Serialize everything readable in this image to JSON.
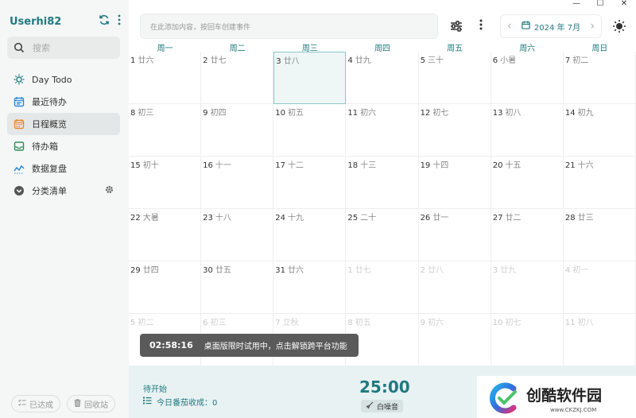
{
  "sidebar": {
    "user_name": "Userhi82",
    "search_placeholder": "搜索",
    "items": [
      {
        "label": "Day Todo",
        "icon": "sun-icon",
        "color": "#1f7a80"
      },
      {
        "label": "最近待办",
        "icon": "calendar-list-icon",
        "color": "#2d8ad6"
      },
      {
        "label": "日程概览",
        "icon": "calendar-grid-icon",
        "color": "#e88a2c"
      },
      {
        "label": "待办箱",
        "icon": "inbox-icon",
        "color": "#2f8f57"
      },
      {
        "label": "数据复盘",
        "icon": "chart-line-icon",
        "color": "#2d8ad6"
      },
      {
        "label": "分类清单",
        "icon": "chevron-down-circle-icon",
        "color": "#555555"
      }
    ],
    "bottom": {
      "completed_label": "已达成",
      "trash_label": "回收站"
    }
  },
  "topbar": {
    "add_placeholder": "在此添加内容，按回车创建事件",
    "month_label": "2024 年 7月"
  },
  "calendar": {
    "weekdays": [
      "周一",
      "周二",
      "周三",
      "周四",
      "周五",
      "周六",
      "周日"
    ],
    "weeks": [
      [
        {
          "d": "1",
          "l": "廿六"
        },
        {
          "d": "2",
          "l": "廿七"
        },
        {
          "d": "3",
          "l": "廿八",
          "today": true
        },
        {
          "d": "4",
          "l": "廿九"
        },
        {
          "d": "5",
          "l": "三十"
        },
        {
          "d": "6",
          "l": "小暑"
        },
        {
          "d": "7",
          "l": "初二"
        }
      ],
      [
        {
          "d": "8",
          "l": "初三"
        },
        {
          "d": "9",
          "l": "初四"
        },
        {
          "d": "10",
          "l": "初五"
        },
        {
          "d": "11",
          "l": "初六"
        },
        {
          "d": "12",
          "l": "初七"
        },
        {
          "d": "13",
          "l": "初八"
        },
        {
          "d": "14",
          "l": "初九"
        }
      ],
      [
        {
          "d": "15",
          "l": "初十"
        },
        {
          "d": "16",
          "l": "十一"
        },
        {
          "d": "17",
          "l": "十二"
        },
        {
          "d": "18",
          "l": "十三"
        },
        {
          "d": "19",
          "l": "十四"
        },
        {
          "d": "20",
          "l": "十五"
        },
        {
          "d": "21",
          "l": "十六"
        }
      ],
      [
        {
          "d": "22",
          "l": "大暑"
        },
        {
          "d": "23",
          "l": "十八"
        },
        {
          "d": "24",
          "l": "十九"
        },
        {
          "d": "25",
          "l": "二十"
        },
        {
          "d": "26",
          "l": "廿一"
        },
        {
          "d": "27",
          "l": "廿二"
        },
        {
          "d": "28",
          "l": "廿三"
        }
      ],
      [
        {
          "d": "29",
          "l": "廿四"
        },
        {
          "d": "30",
          "l": "廿五"
        },
        {
          "d": "31",
          "l": "廿六"
        },
        {
          "d": "1",
          "l": "廿七",
          "dim": true
        },
        {
          "d": "2",
          "l": "廿八",
          "dim": true
        },
        {
          "d": "3",
          "l": "廿九",
          "dim": true
        },
        {
          "d": "4",
          "l": "初一",
          "dim": true
        }
      ],
      [
        {
          "d": "5",
          "l": "初二",
          "dim": true
        },
        {
          "d": "6",
          "l": "初三",
          "dim": true
        },
        {
          "d": "7",
          "l": "立秋",
          "dim": true
        },
        {
          "d": "8",
          "l": "初五",
          "dim": true
        },
        {
          "d": "9",
          "l": "初六",
          "dim": true
        },
        {
          "d": "10",
          "l": "初七",
          "dim": true
        },
        {
          "d": "11",
          "l": "初八",
          "dim": true
        }
      ]
    ]
  },
  "toast": {
    "time": "02:58:16",
    "message": "桌面版限时试用中，点击解锁跨平台功能"
  },
  "bottombar": {
    "status": "待开始",
    "today_count_label": "今日番茄收成：0",
    "timer": "25:00",
    "noise_label": "白噪音"
  },
  "watermark": {
    "title": "创酷软件园",
    "url": "www.CKZKJ.COM"
  },
  "colors": {
    "accent": "#1f7a80",
    "today_bg": "#eef6f6",
    "bottombar_bg": "#e9f2f2"
  }
}
